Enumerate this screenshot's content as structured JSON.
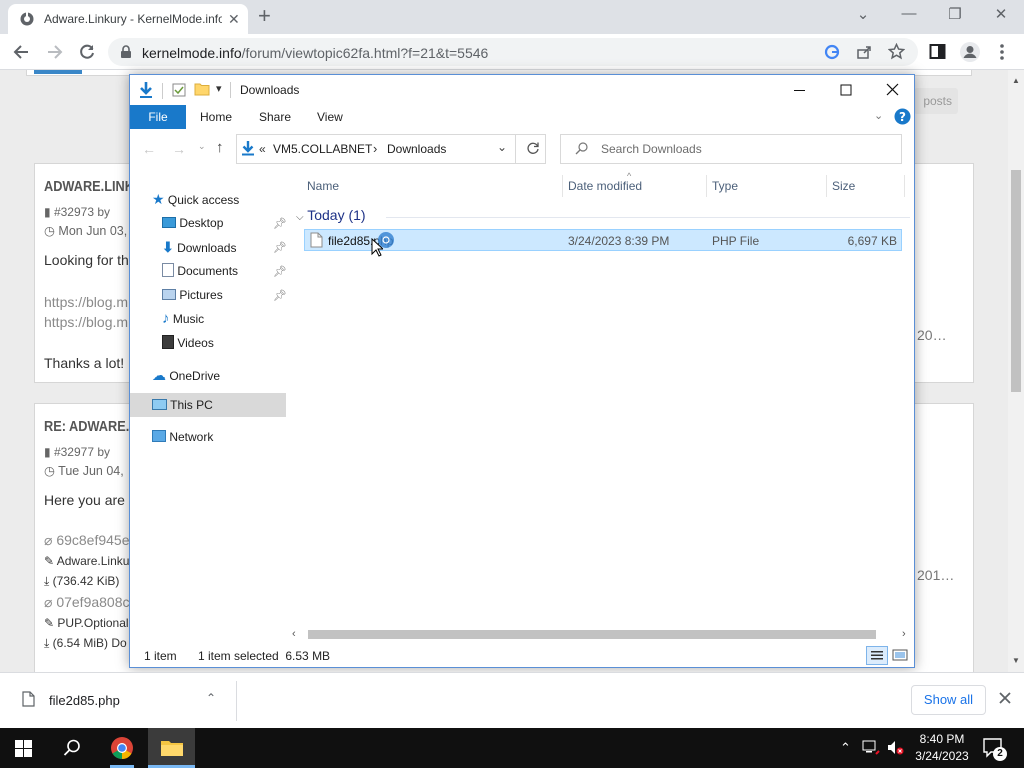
{
  "browser": {
    "tab_title": "Adware.Linkury - KernelMode.info",
    "tab_close": "✕",
    "new_tab": "+",
    "url_host": "kernelmode.info",
    "url_path": "/forum/viewtopic62fa.html?f=21&t=5546",
    "window_controls": [
      "⌄",
      "—",
      "❐",
      "✕"
    ]
  },
  "page": {
    "posts_button": "posts",
    "post1": {
      "title": "ADWARE.LINKURY",
      "id": "#32973",
      "by": "by",
      "date": "Mon Jun 03,",
      "line1": "Looking for th",
      "link1": "https://blog.m",
      "link2": "https://blog.m",
      "thanks": "Thanks a lot!",
      "right_text": "20…"
    },
    "post2": {
      "title": "RE: ADWARE.LI",
      "id": "#32977",
      "by": "by",
      "date": "Tue Jun 04,",
      "line1": "Here you are",
      "att1_link": "69c8ef945e",
      "att1_name": "Adware.Linku",
      "att1_size": "(736.42 KiB)",
      "att2_link": "07ef9a808c",
      "att2_name": "PUP.Optional",
      "att2_size": "(6.54 MiB) Do",
      "right_text": "201…"
    }
  },
  "download_bar": {
    "filename": "file2d85.php",
    "show_all": "Show all"
  },
  "taskbar": {
    "time": "8:40 PM",
    "date": "3/24/2023",
    "notifications": "2"
  },
  "explorer": {
    "title": "Downloads",
    "ribbon_tabs": [
      "File",
      "Home",
      "Share",
      "View"
    ],
    "breadcrumb": [
      "«",
      "VM5.COLLABNET",
      "›",
      "Downloads"
    ],
    "search_placeholder": "Search Downloads",
    "nav": {
      "quick_access": "Quick access",
      "items": [
        "Desktop",
        "Downloads",
        "Documents",
        "Pictures",
        "Music",
        "Videos"
      ],
      "onedrive": "OneDrive",
      "this_pc": "This PC",
      "network": "Network"
    },
    "columns": [
      "Name",
      "Date modified",
      "Type",
      "Size"
    ],
    "group": "Today (1)",
    "files": [
      {
        "name": "file2d85.php",
        "date": "3/24/2023 8:39 PM",
        "type": "PHP File",
        "size": "6,697 KB"
      }
    ],
    "status_count": "1 item",
    "status_selected": "1 item selected  6.53 MB"
  },
  "colors": {
    "accent": "#1979ca",
    "selection": "#cce8ff",
    "selection_border": "#99d1ff"
  }
}
